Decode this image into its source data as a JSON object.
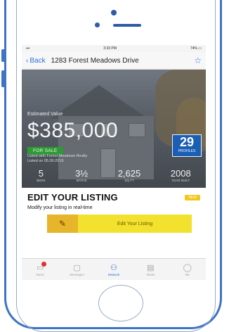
{
  "status_bar": {
    "time": "3:33 PM",
    "battery": "74%"
  },
  "nav": {
    "back_label": "Back",
    "title": "1283 Forest Meadows Drive"
  },
  "hero": {
    "estimate_label": "Estimated Value",
    "price": "$385,000",
    "sale_badge": "FOR SALE",
    "listed_by": "Listed with Forest Meadows Realty",
    "listed_since": "Listed on 05.09.2019",
    "days_number": "29",
    "days_label": "PROFILES",
    "stats": [
      {
        "value": "5",
        "label": "BEDS"
      },
      {
        "value": "3½",
        "label": "BATHS"
      },
      {
        "value": "2,625",
        "label": "SQ FT"
      },
      {
        "value": "2008",
        "label": "YEAR BUILT"
      }
    ]
  },
  "edit": {
    "title": "EDIT YOUR LISTING",
    "badge": "NEW",
    "subtitle": "Modify your listing in real-time",
    "button_label": "Edit Your Listing"
  },
  "tabs": [
    {
      "label": "News",
      "icon": "news-icon",
      "active": false
    },
    {
      "label": "Messages",
      "icon": "message-icon",
      "active": false
    },
    {
      "label": "Network",
      "icon": "network-icon",
      "active": true
    },
    {
      "label": "Deals",
      "icon": "deals-icon",
      "active": false
    },
    {
      "label": "Me",
      "icon": "profile-icon",
      "active": false
    }
  ],
  "colors": {
    "accent": "#2f6fd6",
    "sale_green": "#2e9a35",
    "edit_yellow": "#f2e22e",
    "days_blue": "#1b5fb4"
  }
}
